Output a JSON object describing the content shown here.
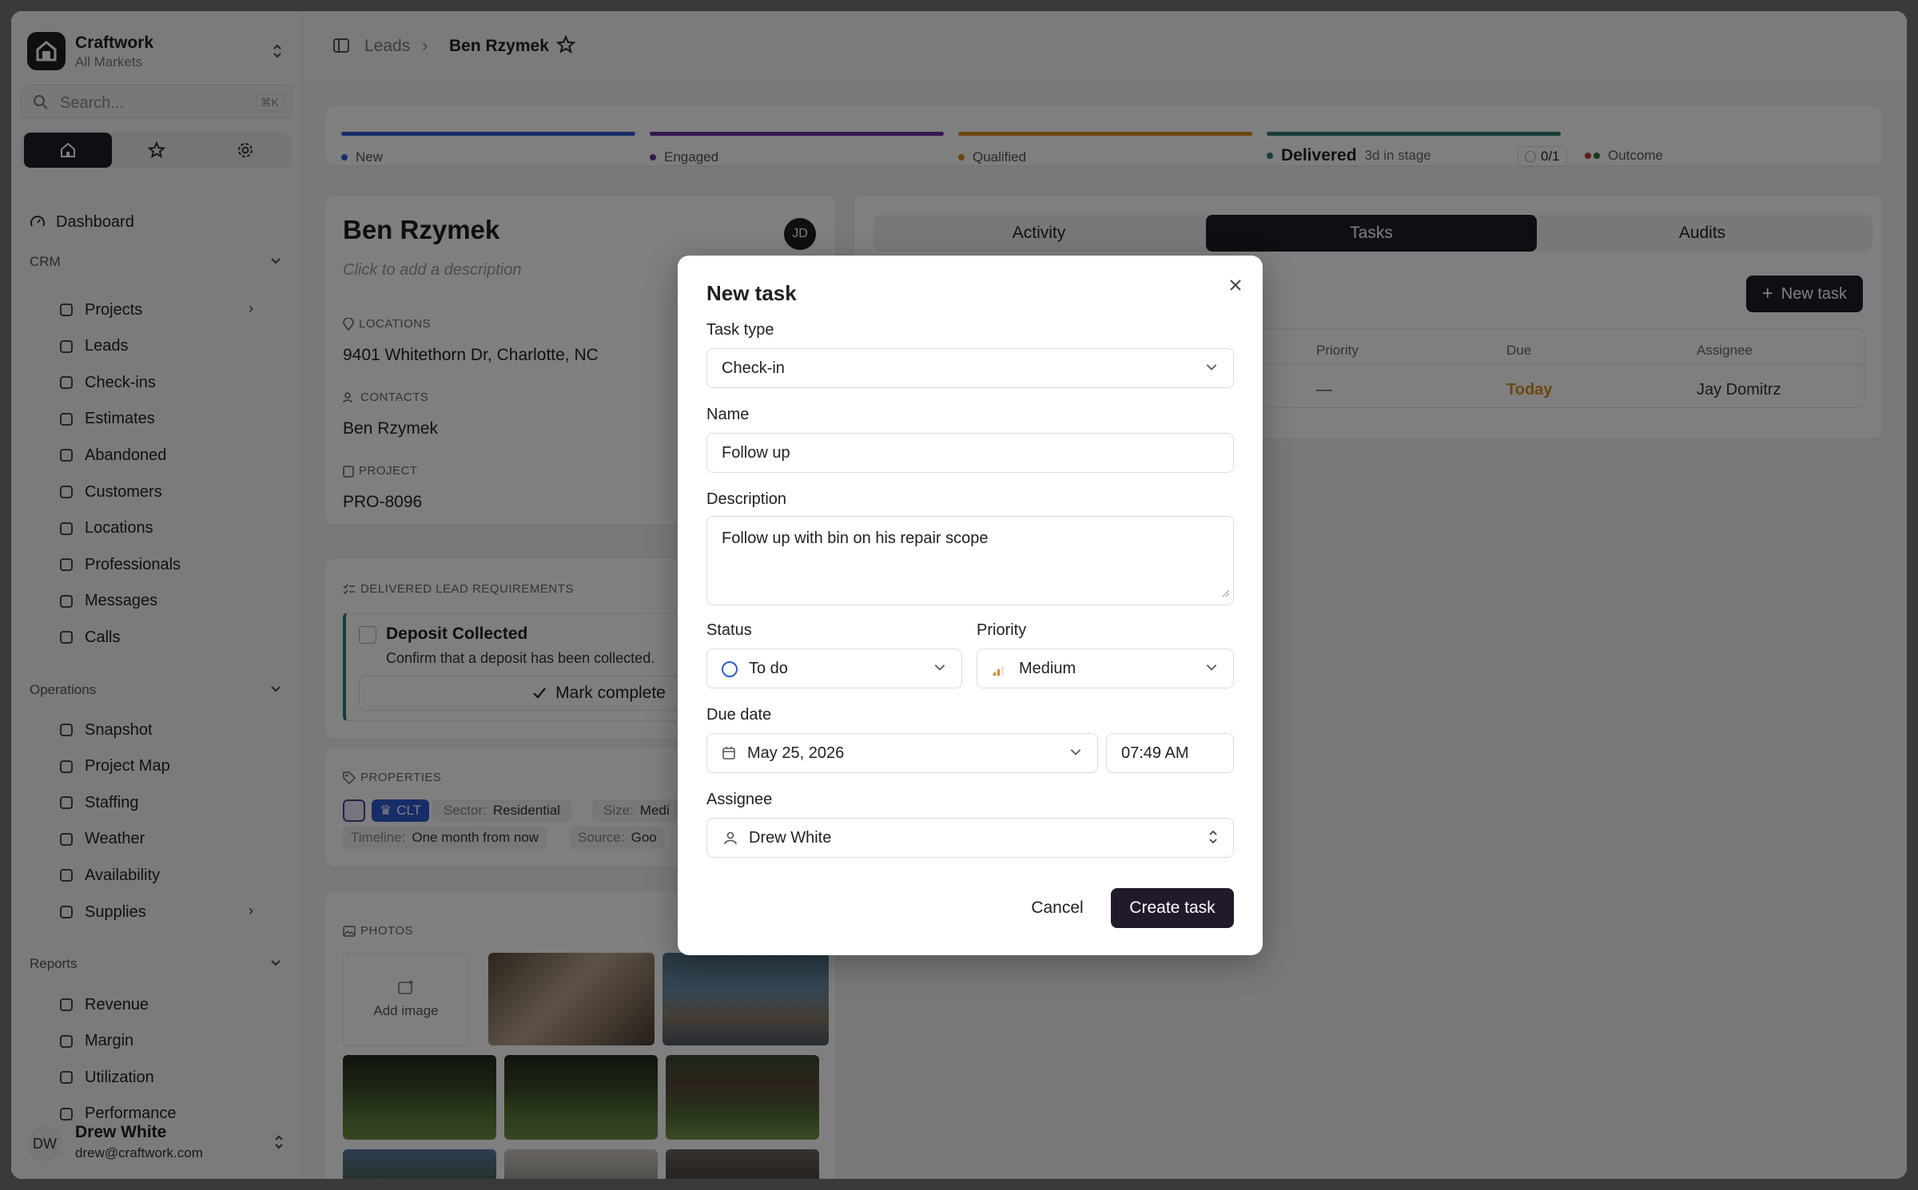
{
  "brand": {
    "name": "Craftwork",
    "subtitle": "All Markets"
  },
  "search": {
    "placeholder": "Search...",
    "shortcut": "⌘K"
  },
  "sidebar": {
    "dashboard": "Dashboard",
    "crm_header": "CRM",
    "crm_items": [
      "Projects",
      "Leads",
      "Check-ins",
      "Estimates",
      "Abandoned",
      "Customers",
      "Locations",
      "Professionals",
      "Messages",
      "Calls"
    ],
    "ops_header": "Operations",
    "ops_items": [
      "Snapshot",
      "Project Map",
      "Staffing",
      "Weather",
      "Availability",
      "Supplies"
    ],
    "reports_header": "Reports",
    "reports_items": [
      "Revenue",
      "Margin",
      "Utilization",
      "Performance"
    ]
  },
  "user": {
    "initials": "DW",
    "name": "Drew White",
    "email": "drew@craftwork.com"
  },
  "breadcrumb": {
    "parent": "Leads",
    "current": "Ben Rzymek"
  },
  "stages": [
    {
      "label": "New",
      "color": "#2f5bd3"
    },
    {
      "label": "Engaged",
      "color": "#6b2fa3"
    },
    {
      "label": "Qualified",
      "color": "#d88a1c"
    },
    {
      "label": "Delivered",
      "color": "#2b7a72",
      "meta": "3d in stage",
      "count": "0/1"
    },
    {
      "label": "Outcome",
      "color": "#c43c3c"
    }
  ],
  "lead": {
    "name": "Ben Rzymek",
    "description_placeholder": "Click to add a description",
    "owner_initials": "JD",
    "locations_label": "LOCATIONS",
    "location": "9401 Whitethorn Dr, Charlotte, NC",
    "contacts_label": "CONTACTS",
    "contact": "Ben Rzymek",
    "project_label": "PROJECT",
    "project": "PRO-8096"
  },
  "requirements": {
    "header": "DELIVERED LEAD REQUIREMENTS",
    "title": "Deposit Collected",
    "desc": "Confirm that a deposit has been collected.",
    "action": "Mark complete"
  },
  "properties": {
    "header": "PROPERTIES",
    "market": "CLT",
    "sector_label": "Sector:",
    "sector": "Residential",
    "size_label": "Size:",
    "size": "Medi",
    "timeline_label": "Timeline:",
    "timeline": "One month from now",
    "source_label": "Source:",
    "source": "Goo"
  },
  "photos": {
    "header": "PHOTOS",
    "add": "Add image"
  },
  "tabs": [
    "Activity",
    "Tasks",
    "Audits"
  ],
  "tasks": {
    "new_button": "New task",
    "columns": [
      "Priority",
      "Due",
      "Assignee"
    ],
    "row": {
      "priority": "—",
      "due": "Today",
      "assignee": "Jay Domitrz"
    }
  },
  "modal": {
    "title": "New task",
    "task_type_label": "Task type",
    "task_type": "Check-in",
    "name_label": "Name",
    "name": "Follow up",
    "description_label": "Description",
    "description": "Follow up with bin on his repair scope",
    "status_label": "Status",
    "status": "To do",
    "priority_label": "Priority",
    "priority": "Medium",
    "due_label": "Due date",
    "due_date": "May 25, 2026",
    "due_time": "07:49 AM",
    "assignee_label": "Assignee",
    "assignee": "Drew White",
    "cancel": "Cancel",
    "create": "Create task"
  }
}
